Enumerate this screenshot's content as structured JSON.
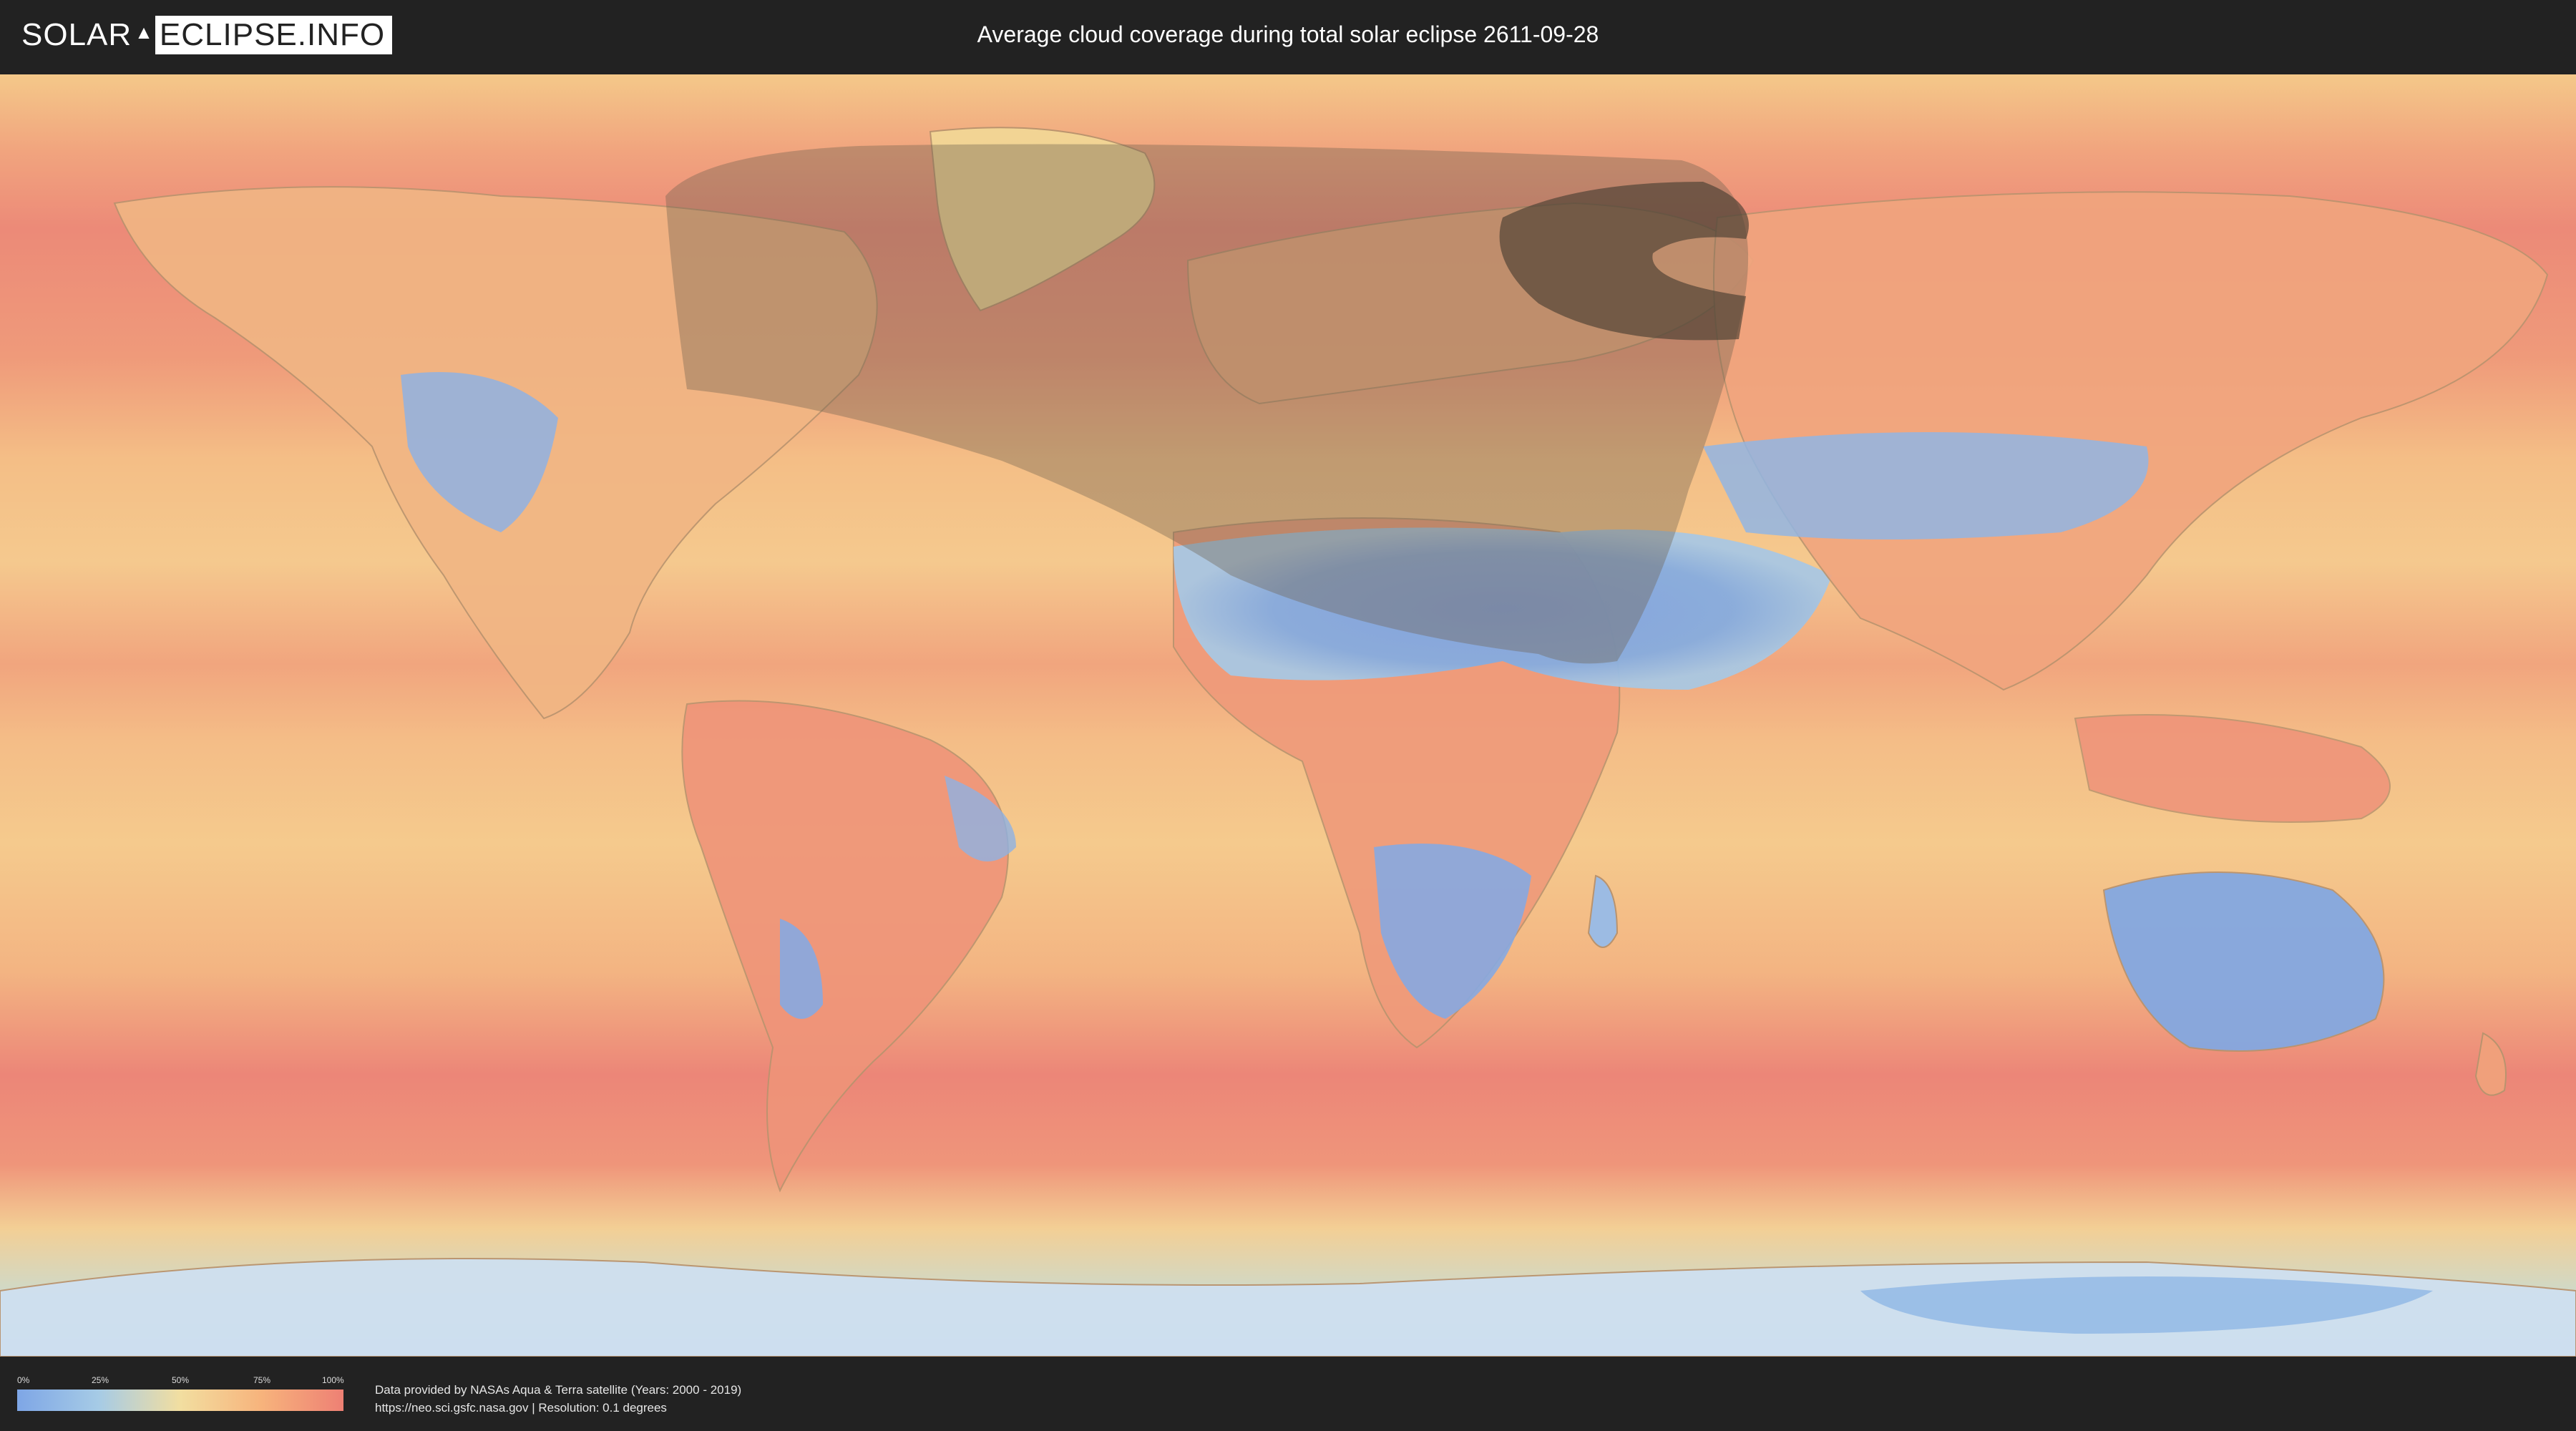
{
  "header": {
    "logo_text_left": "SOLAR",
    "logo_text_right": "ECLIPSE.INFO",
    "title": "Average cloud coverage during total solar eclipse 2611-09-28"
  },
  "map": {
    "description_colors": {
      "clear": "#7ea6e6",
      "light": "#a6cbe6",
      "mid": "#f2dea0",
      "heavy": "#f7b37c",
      "full": "#ee8074"
    },
    "eclipse_shadow_color": "#5a5040"
  },
  "footer": {
    "legend": {
      "ticks": [
        "0%",
        "25%",
        "50%",
        "75%",
        "100%"
      ],
      "gradient_colors": [
        "#7ea6e6",
        "#a6cbe6",
        "#f2dea0",
        "#f7b37c",
        "#ee8074"
      ]
    },
    "credits": {
      "line1": "Data provided by NASAs Aqua & Terra satellite (Years: 2000 - 2019)",
      "line2": "https://neo.sci.gsfc.nasa.gov | Resolution: 0.1 degrees"
    }
  }
}
